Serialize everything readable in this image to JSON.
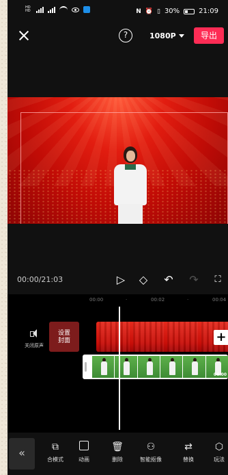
{
  "status_bar": {
    "left_hd": "HD 1\nHD 2",
    "signal1": "46",
    "signal2": "4G",
    "battery_pct": "30%",
    "time": "21:09"
  },
  "top_bar": {
    "help_label": "?",
    "resolution": "1080P",
    "export_label": "导出"
  },
  "player": {
    "timecode": "00:00/21:03"
  },
  "timeline": {
    "ruler": [
      "00:00",
      "·",
      "00:02",
      "·",
      "00:04"
    ],
    "mute_label": "关闭原声",
    "cover_label_line1": "设置",
    "cover_label_line2": "封面",
    "clip_duration": "06:00",
    "add_label": "+"
  },
  "toolbar": {
    "collapse": "«",
    "items": [
      {
        "label": "合模式",
        "icon": "picture-in-picture-icon"
      },
      {
        "label": "动画",
        "icon": "animation-icon"
      },
      {
        "label": "删除",
        "icon": "delete-icon"
      },
      {
        "label": "智能抠像",
        "icon": "smart-cutout-icon"
      },
      {
        "label": "替换",
        "icon": "replace-icon"
      },
      {
        "label": "玩法",
        "icon": "effects-icon"
      }
    ]
  },
  "colors": {
    "accent": "#fe2c55",
    "background": "#111111"
  }
}
